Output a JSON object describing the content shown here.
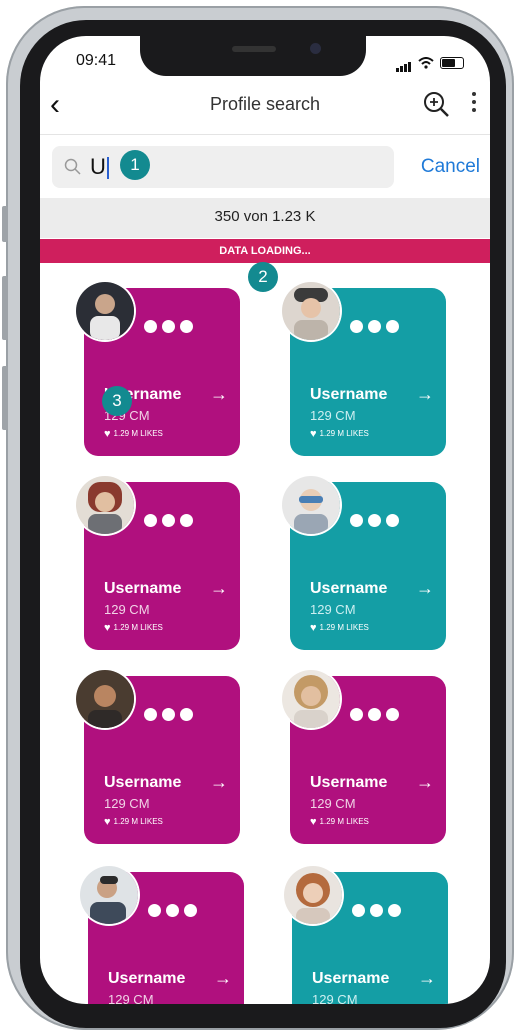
{
  "status": {
    "time": "09:41"
  },
  "nav": {
    "title": "Profile search"
  },
  "search": {
    "value": "U",
    "cancel_label": "Cancel"
  },
  "badges": [
    "1",
    "2",
    "3"
  ],
  "results": {
    "count_text": "350 von 1.23 K",
    "loading_text": "DATA LOADING..."
  },
  "profiles": [
    {
      "color": "#b0107e",
      "username": "Username",
      "height": "129 CM",
      "likes": "1.29 M LIKES"
    },
    {
      "color": "#149ea5",
      "username": "Username",
      "height": "129 CM",
      "likes": "1.29 M LIKES"
    },
    {
      "color": "#b0107e",
      "username": "Username",
      "height": "129 CM",
      "likes": "1.29 M LIKES"
    },
    {
      "color": "#149ea5",
      "username": "Username",
      "height": "129 CM",
      "likes": "1.29 M LIKES"
    },
    {
      "color": "#b0107e",
      "username": "Username",
      "height": "129 CM",
      "likes": "1.29 M LIKES"
    },
    {
      "color": "#b0107e",
      "username": "Username",
      "height": "129 CM",
      "likes": "1.29 M LIKES"
    },
    {
      "color": "#b0107e",
      "username": "Username",
      "height": "129 CM",
      "likes": ""
    },
    {
      "color": "#149ea5",
      "username": "Username",
      "height": "129 CM",
      "likes": ""
    }
  ],
  "colors": {
    "accent_blue": "#1f7ad8",
    "loading": "#cf1f5d",
    "badge": "#138a90"
  }
}
